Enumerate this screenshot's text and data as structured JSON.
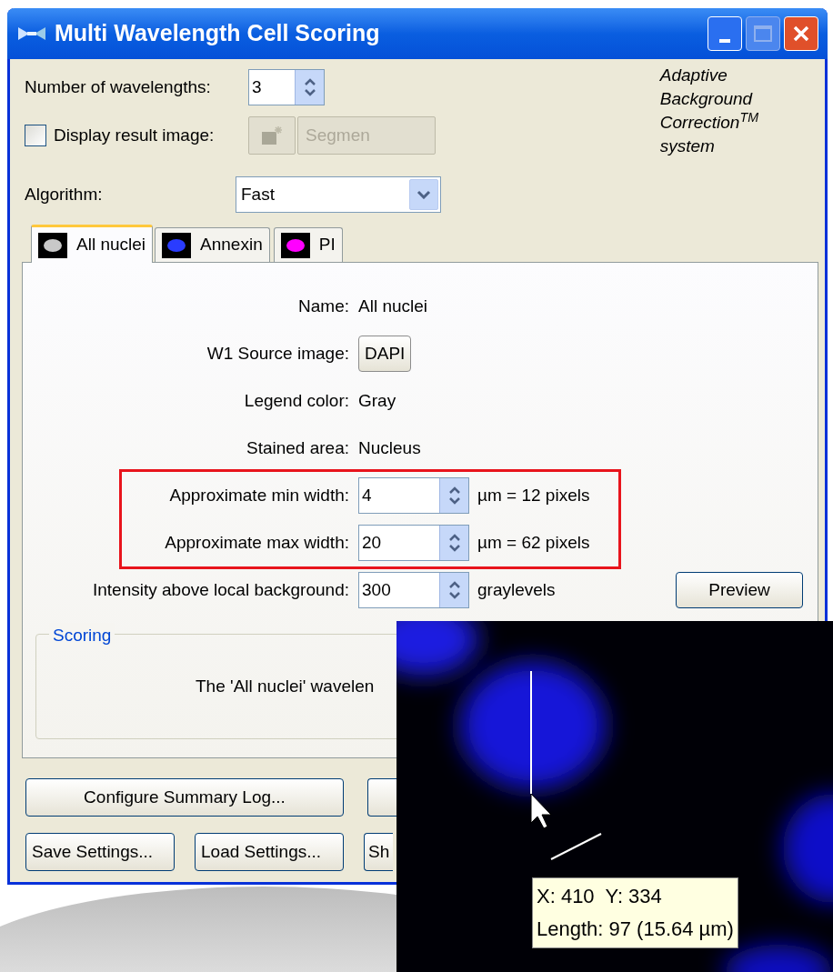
{
  "window": {
    "title": "Multi Wavelength Cell Scoring"
  },
  "wavelengths": {
    "label": "Number of wavelengths:",
    "value": "3"
  },
  "display_result": {
    "label": "Display result image:",
    "checked": false,
    "button": "Segmen",
    "disabled": true
  },
  "branding": {
    "lines": [
      "Adaptive",
      "Background",
      "Correction$^{TM}$",
      "system"
    ]
  },
  "algorithm": {
    "label": "Algorithm:",
    "value": "Fast"
  },
  "tabs": [
    {
      "label": "All nuclei",
      "selected": true,
      "color": "#c8c8c8"
    },
    {
      "label": "Annexin",
      "selected": false,
      "color": "#2a3cff"
    },
    {
      "label": "PI",
      "selected": false,
      "color": "#ff00ff"
    }
  ],
  "fields": [
    {
      "kind": "text",
      "label": "Name:",
      "value": "All nuclei",
      "highlighted": false
    },
    {
      "kind": "button",
      "label": "W1 Source image:",
      "value": "DAPI",
      "highlighted": false
    },
    {
      "kind": "text",
      "label": "Legend color:",
      "value": "Gray",
      "highlighted": false
    },
    {
      "kind": "text",
      "label": "Stained area:",
      "value": "Nucleus",
      "highlighted": false
    },
    {
      "kind": "spin",
      "label": "Approximate min width:",
      "value": "4",
      "suffix": "µm = 12 pixels",
      "highlighted": true
    },
    {
      "kind": "spin",
      "label": "Approximate max width:",
      "value": "20",
      "suffix": "µm = 62 pixels",
      "highlighted": true
    },
    {
      "kind": "spin",
      "label": "Intensity above local background:",
      "value": "300",
      "suffix": "graylevels",
      "highlighted": false
    }
  ],
  "preview_button": "Preview",
  "scoring": {
    "legend": "Scoring",
    "text": "The 'All nuclei' wavelen"
  },
  "bottom_buttons": [
    [
      "Configure Summary Log..."
    ],
    [
      "Save Settings...",
      "Load Settings...",
      "Sh"
    ]
  ],
  "tooltip": {
    "lines": [
      "X: 410  Y: 334",
      "Length: 97 (15.64 µm)"
    ]
  }
}
